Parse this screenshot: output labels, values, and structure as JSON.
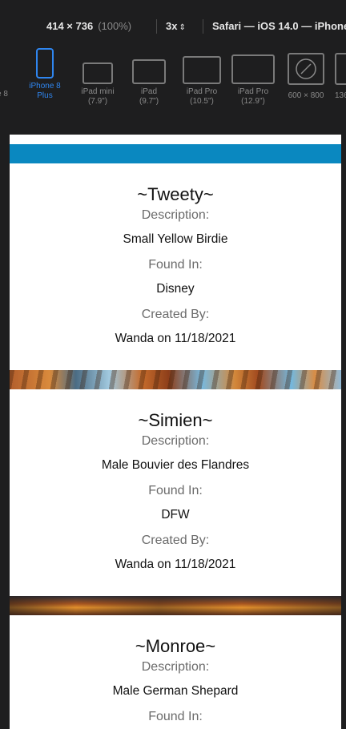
{
  "toolbar": {
    "dimensions": "414 × 736",
    "zoom": "(100%)",
    "scale": "3x",
    "scale_chevron": "⌃⌄",
    "browser": "Safari — iOS 14.0 — iPhone"
  },
  "devices": [
    {
      "label": "e 8",
      "sub": ""
    },
    {
      "label": "iPhone 8",
      "sub": "Plus"
    },
    {
      "label": "iPad mini",
      "sub": "(7.9\")"
    },
    {
      "label": "iPad",
      "sub": "(9.7\")"
    },
    {
      "label": "iPad Pro",
      "sub": "(10.5\")"
    },
    {
      "label": "iPad Pro",
      "sub": "(12.9\")"
    },
    {
      "label": "600 × 800",
      "sub": ""
    },
    {
      "label": "136",
      "sub": ""
    }
  ],
  "cards": [
    {
      "name": "~Tweety~",
      "description_label": "Description:",
      "description": "Small Yellow Birdie",
      "found_label": "Found In:",
      "found": "Disney",
      "created_label": "Created By:",
      "created": "Wanda on 11/18/2021"
    },
    {
      "name": "~Simien~",
      "description_label": "Description:",
      "description": "Male Bouvier des Flandres",
      "found_label": "Found In:",
      "found": "DFW",
      "created_label": "Created By:",
      "created": "Wanda on 11/18/2021"
    },
    {
      "name": "~Monroe~",
      "description_label": "Description:",
      "description": "Male German Shepard",
      "found_label": "Found In:"
    }
  ],
  "colors": {
    "accent_blue": "#2f86f0",
    "strip_blue": "#0a88c0"
  }
}
